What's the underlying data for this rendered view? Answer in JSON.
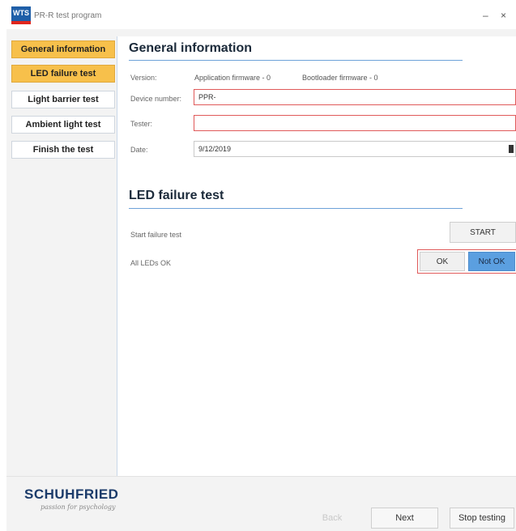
{
  "window": {
    "title": "PR-R test program",
    "minimize_glyph": "–",
    "close_glyph": "×",
    "logo_text": "WTS"
  },
  "sidebar": {
    "items": [
      {
        "label": "General information",
        "state": "active"
      },
      {
        "label": "LED failure test",
        "state": "highlighted"
      },
      {
        "label": "Light barrier test",
        "state": "normal"
      },
      {
        "label": "Ambient light test",
        "state": "normal"
      },
      {
        "label": "Finish the test",
        "state": "normal"
      }
    ]
  },
  "general": {
    "title": "General information",
    "version_label": "Version:",
    "app_fw": "Application firmware - 0",
    "boot_fw": "Bootloader firmware - 0",
    "device_label": "Device number:",
    "device_value": "PPR-",
    "tester_label": "Tester:",
    "tester_value": "",
    "date_label": "Date:",
    "date_value": "9/12/2019"
  },
  "led": {
    "title": "LED failure test",
    "start_label": "Start failure test",
    "start_button": "START",
    "all_ok_label": "All LEDs OK",
    "ok_button": "OK",
    "not_ok_button": "Not OK"
  },
  "footer": {
    "brand": "SCHUHFRIED",
    "tagline": "passion for psychology",
    "back_button": "Back",
    "next_button": "Next",
    "stop_button": "Stop testing"
  },
  "colors": {
    "nav_highlight": "#f7c04b",
    "section_line": "#6ea2d8",
    "error_border": "#e05a5a",
    "not_ok_selected": "#5b9fe0"
  }
}
